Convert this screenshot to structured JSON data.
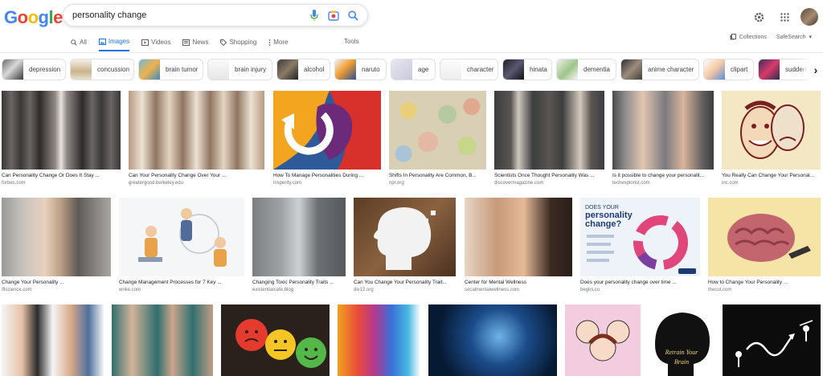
{
  "logo": "Google",
  "search": {
    "query": "personality change"
  },
  "tabs": [
    {
      "label": "All",
      "icon": "search-icon",
      "active": false
    },
    {
      "label": "Images",
      "icon": "image-icon",
      "active": true
    },
    {
      "label": "Videos",
      "icon": "video-icon",
      "active": false
    },
    {
      "label": "News",
      "icon": "news-icon",
      "active": false
    },
    {
      "label": "Shopping",
      "icon": "tag-icon",
      "active": false
    },
    {
      "label": "More",
      "icon": "more-dots-icon",
      "active": false
    }
  ],
  "tools_label": "Tools",
  "collections_label": "Collections",
  "safesearch_label": "SafeSearch",
  "chips": [
    {
      "label": "depression"
    },
    {
      "label": "concussion"
    },
    {
      "label": "brain tumor"
    },
    {
      "label": "brain injury"
    },
    {
      "label": "alcohol"
    },
    {
      "label": "naruto"
    },
    {
      "label": "age"
    },
    {
      "label": "character"
    },
    {
      "label": "hinata"
    },
    {
      "label": "dementia"
    },
    {
      "label": "anime character"
    },
    {
      "label": "clipart"
    },
    {
      "label": "sudden"
    }
  ],
  "results_row1": [
    {
      "title": "Can Personality Change Or Does It Stay ...",
      "source": "forbes.com"
    },
    {
      "title": "Can Your Personality Change Over Your ...",
      "source": "greatergood.berkeley.edu"
    },
    {
      "title": "How To Manage Personalities During ...",
      "source": "insperity.com"
    },
    {
      "title": "Shifts In Personality Are Common, B...",
      "source": "npr.org"
    },
    {
      "title": "Scientists Once Thought Personality Was ...",
      "source": "discovermagazine.com"
    },
    {
      "title": "Is it possible to change your personalit...",
      "source": "techexplorist.com"
    },
    {
      "title": "You Really Can Change Your Personal...",
      "source": "inc.com"
    }
  ],
  "results_row2": [
    {
      "title": "Change Your Personality ...",
      "source": "iflscience.com"
    },
    {
      "title": "Change Management Processes for 7 Key ...",
      "source": "wrike.com"
    },
    {
      "title": "Changing Toxic Personality Traits ...",
      "source": "existentialcafe.blog"
    },
    {
      "title": "Can You Change Your Personality Trait...",
      "source": "div12.org"
    },
    {
      "title": "Center for Mental Wellness",
      "source": "socalmentalwellness.com"
    },
    {
      "title": "Does your personality change over time ...",
      "source": "begini.co"
    },
    {
      "title": "How to Change Your Personality ...",
      "source": "thecut.com"
    }
  ],
  "image_text": {
    "personality_poster_line1": "DOES YOUR",
    "personality_poster_line2": "personality",
    "personality_poster_line3": "change?",
    "retrain_line1": "Retrain Your",
    "retrain_line2": "Brain"
  }
}
